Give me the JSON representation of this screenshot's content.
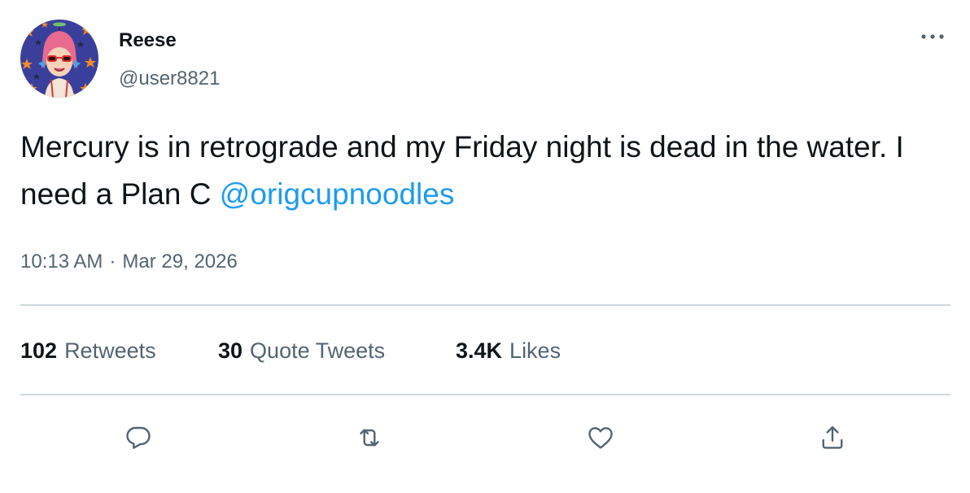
{
  "author": {
    "display_name": "Reese",
    "handle": "@user8821"
  },
  "tweet": {
    "text_before_mention": "Mercury is in retrograde and my Friday night is dead in the water. I need a Plan C ",
    "mention": "@origcupnoodles",
    "time": "10:13 AM",
    "separator": "·",
    "date": "Mar 29, 2026"
  },
  "stats": {
    "retweets_count": "102",
    "retweets_label": "Retweets",
    "quotes_count": "30",
    "quotes_label": "Quote Tweets",
    "likes_count": "3.4K",
    "likes_label": "Likes"
  },
  "icons": {
    "more": "more-horizontal-icon",
    "reply": "reply-icon",
    "retweet": "retweet-icon",
    "like": "heart-icon",
    "share": "share-icon"
  },
  "colors": {
    "link": "#1d9bf0",
    "secondary_text": "#536471",
    "divider": "#cfd9de",
    "primary_text": "#0f1419"
  }
}
